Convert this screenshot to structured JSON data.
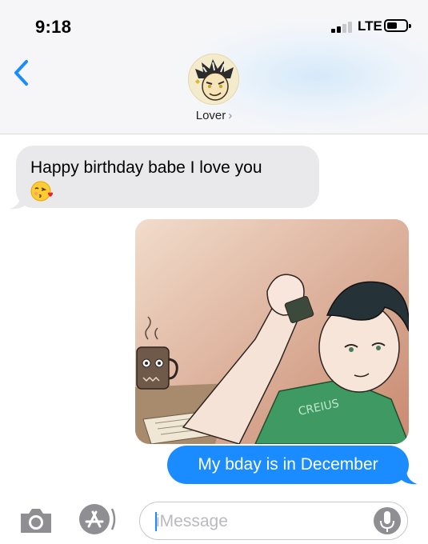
{
  "status_bar": {
    "time": "9:18",
    "carrier": "LTE",
    "signal_bars_active": 2,
    "signal_bars_total": 4,
    "battery_level": 0.35
  },
  "header": {
    "back_icon": "chevron-left-icon",
    "contact_name": "Lover",
    "contact_chevron": "›"
  },
  "messages": [
    {
      "direction": "incoming",
      "text": "Happy birthday babe I love you",
      "emoji": "kissing-face-with-heart-emoji"
    },
    {
      "direction": "outgoing",
      "type": "image",
      "description_icon": "drawing-image"
    },
    {
      "direction": "outgoing",
      "text": "My bday is in December"
    }
  ],
  "image_caption_text": "CREIUS",
  "input_bar": {
    "camera_icon": "camera-icon",
    "apps_icon": "app-store-icon",
    "placeholder": "iMessage",
    "mic_icon": "microphone-icon"
  },
  "colors": {
    "outgoing_bubble": "#1a8cff",
    "incoming_bubble": "#e9e9eb",
    "accent": "#1a8cff"
  }
}
